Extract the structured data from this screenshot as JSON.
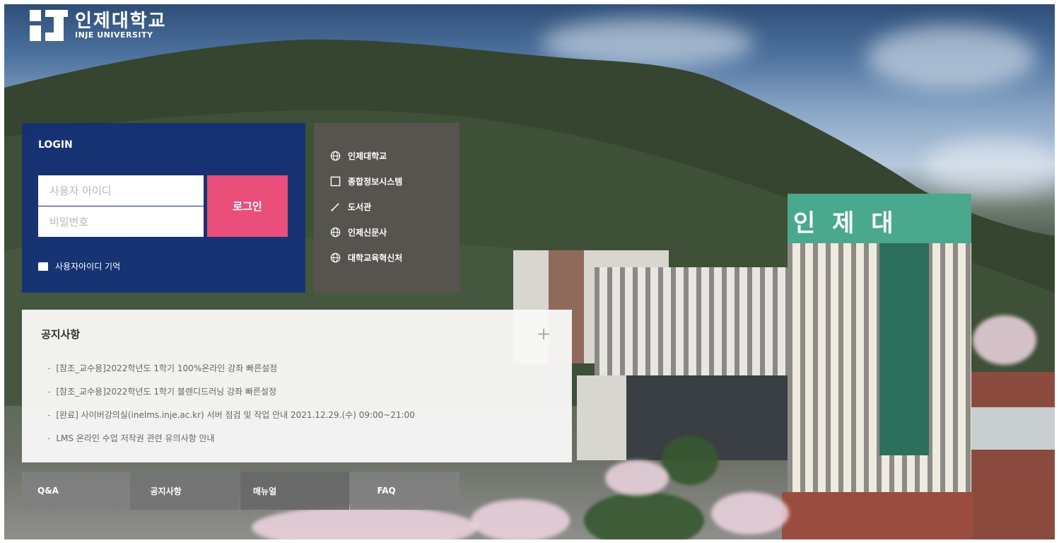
{
  "logo": {
    "korean": "인제대학교",
    "english": "INJE UNIVERSITY"
  },
  "login": {
    "title": "LOGIN",
    "username_placeholder": "사용자 아이디",
    "password_placeholder": "비밀번호",
    "button_label": "로그인",
    "remember_label": "사용자아이디 기억"
  },
  "links": [
    {
      "label": "인제대학교",
      "icon": "globe-icon"
    },
    {
      "label": "종합정보시스템",
      "icon": "window-icon"
    },
    {
      "label": "도서관",
      "icon": "pen-icon"
    },
    {
      "label": "인제신문사",
      "icon": "globe-icon"
    },
    {
      "label": "대학교육혁신처",
      "icon": "globe-icon"
    }
  ],
  "notice": {
    "title": "공지사항",
    "more": "+",
    "items": [
      "[참조_교수용]2022학년도 1학기 100%온라인 강좌 빠른설정",
      "[참조_교수용]2022학년도 1학기 블렌디드러닝 강좌 빠른설정",
      "[완료] 사이버강의실(inelms.inje.ac.kr) 서버 점검 및 작업 안내 2021.12.29.(수) 09:00~21:00",
      "LMS 온라인 수업 저작권 관련 유의사항 안내"
    ]
  },
  "bottom_menu": [
    "Q&A",
    "공지사항",
    "매뉴얼",
    "FAQ"
  ],
  "colors": {
    "login_panel": "#12307a",
    "login_button": "#ea4f7c",
    "links_panel": "#58544f",
    "notice_panel": "#f8f8f8"
  }
}
